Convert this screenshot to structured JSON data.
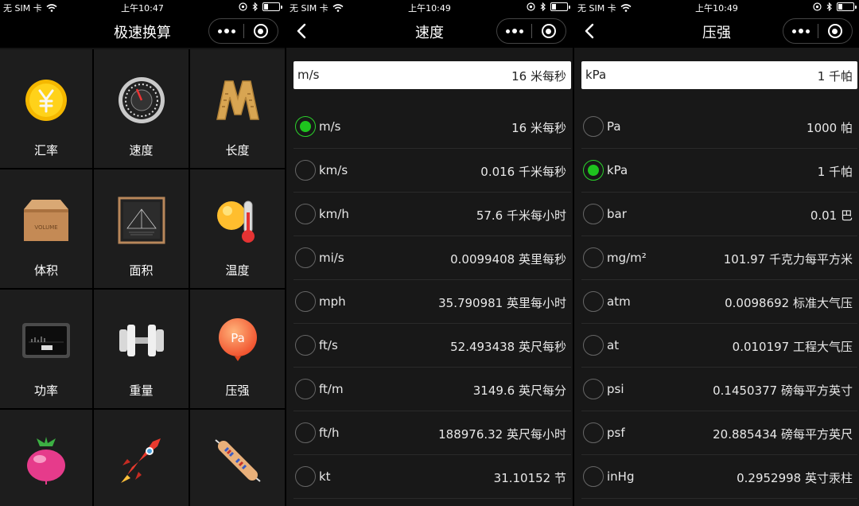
{
  "status": {
    "carrier": "无 SIM 卡"
  },
  "panels": [
    {
      "time": "上午10:47",
      "title": "极速换算",
      "tiles": [
        {
          "label": "汇率",
          "icon": "yuan-coin-icon"
        },
        {
          "label": "速度",
          "icon": "speedometer-icon"
        },
        {
          "label": "长度",
          "icon": "ruler-m-icon"
        },
        {
          "label": "体积",
          "icon": "volume-box-icon"
        },
        {
          "label": "面积",
          "icon": "area-frame-icon"
        },
        {
          "label": "温度",
          "icon": "thermometer-icon"
        },
        {
          "label": "功率",
          "icon": "power-meter-icon"
        },
        {
          "label": "重量",
          "icon": "dumbbell-icon"
        },
        {
          "label": "压强",
          "icon": "pa-balloon-icon"
        },
        {
          "label": "",
          "icon": "radish-icon"
        },
        {
          "label": "",
          "icon": "rocket-icon"
        },
        {
          "label": "",
          "icon": "resistor-icon"
        }
      ]
    },
    {
      "time": "上午10:49",
      "title": "速度",
      "input": {
        "unit": "m/s",
        "value": "16  米每秒"
      },
      "rows": [
        {
          "unit": "m/s",
          "value": "16 米每秒",
          "selected": true
        },
        {
          "unit": "km/s",
          "value": "0.016 千米每秒",
          "selected": false
        },
        {
          "unit": "km/h",
          "value": "57.6 千米每小时",
          "selected": false
        },
        {
          "unit": "mi/s",
          "value": "0.0099408 英里每秒",
          "selected": false
        },
        {
          "unit": "mph",
          "value": "35.790981 英里每小时",
          "selected": false
        },
        {
          "unit": "ft/s",
          "value": "52.493438 英尺每秒",
          "selected": false
        },
        {
          "unit": "ft/m",
          "value": "3149.6 英尺每分",
          "selected": false
        },
        {
          "unit": "ft/h",
          "value": "188976.32 英尺每小时",
          "selected": false
        },
        {
          "unit": "kt",
          "value": "31.10152 节",
          "selected": false
        }
      ]
    },
    {
      "time": "上午10:49",
      "title": "压强",
      "input": {
        "unit": "kPa",
        "value": "1  千帕"
      },
      "rows": [
        {
          "unit": "Pa",
          "value": "1000 帕",
          "selected": false
        },
        {
          "unit": "kPa",
          "value": "1 千帕",
          "selected": true
        },
        {
          "unit": "bar",
          "value": "0.01 巴",
          "selected": false
        },
        {
          "unit": "mg/m²",
          "value": "101.97 千克力每平方米",
          "selected": false
        },
        {
          "unit": "atm",
          "value": "0.0098692 标准大气压",
          "selected": false
        },
        {
          "unit": "at",
          "value": "0.010197 工程大气压",
          "selected": false
        },
        {
          "unit": "psi",
          "value": "0.1450377 磅每平方英寸",
          "selected": false
        },
        {
          "unit": "psf",
          "value": "20.885434 磅每平方英尺",
          "selected": false
        },
        {
          "unit": "inHg",
          "value": "0.2952998 英寸汞柱",
          "selected": false
        }
      ]
    }
  ]
}
